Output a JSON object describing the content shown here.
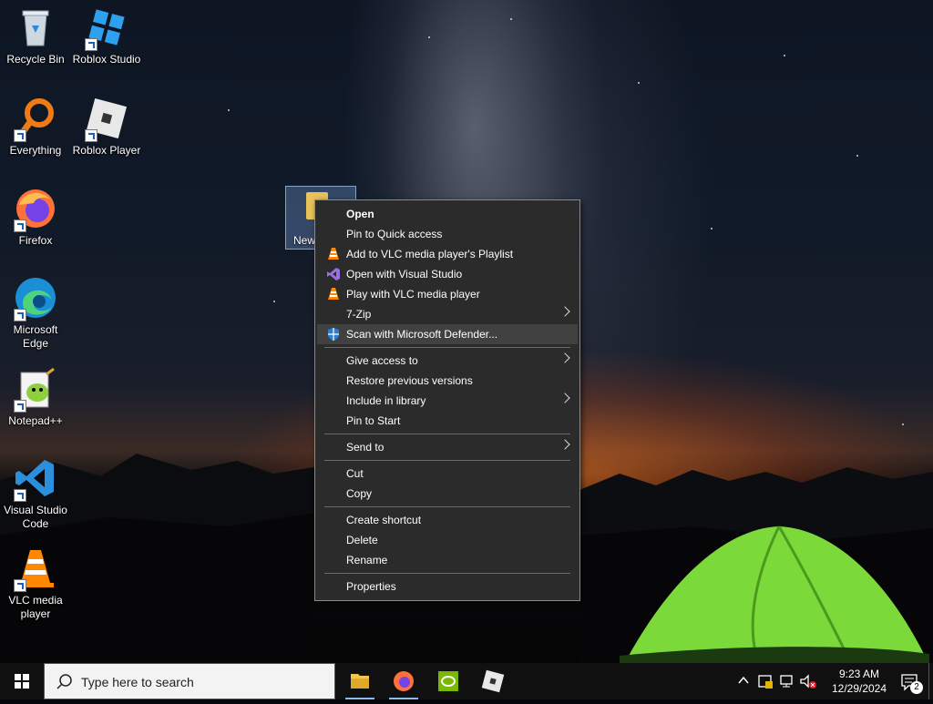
{
  "desktop_icons": [
    {
      "label": "Recycle Bin",
      "icon": "recycle-bin-icon"
    },
    {
      "label": "Roblox Studio",
      "icon": "roblox-studio-icon"
    },
    {
      "label": "Everything",
      "icon": "everything-icon"
    },
    {
      "label": "Roblox Player",
      "icon": "roblox-player-icon"
    },
    {
      "label": "Firefox",
      "icon": "firefox-icon"
    },
    {
      "label": "Microsoft Edge",
      "icon": "edge-icon"
    },
    {
      "label": "Notepad++",
      "icon": "notepad-plus-plus-icon"
    },
    {
      "label": "Visual Studio Code",
      "icon": "vscode-icon"
    },
    {
      "label": "VLC media player",
      "icon": "vlc-icon"
    }
  ],
  "selected_item": {
    "label": "New"
  },
  "context_menu": {
    "items": [
      {
        "label": "Open",
        "bold": true
      },
      {
        "label": "Pin to Quick access"
      },
      {
        "label": "Add to VLC media player's Playlist",
        "icon": "vlc-icon"
      },
      {
        "label": "Open with Visual Studio",
        "icon": "visual-studio-icon"
      },
      {
        "label": "Play with VLC media player",
        "icon": "vlc-icon"
      },
      {
        "label": "7-Zip",
        "submenu": true
      },
      {
        "label": "Scan with Microsoft Defender...",
        "icon": "defender-shield-icon",
        "highlighted": true
      },
      {
        "label": "Give access to",
        "submenu": true
      },
      {
        "label": "Restore previous versions"
      },
      {
        "label": "Include in library",
        "submenu": true
      },
      {
        "label": "Pin to Start"
      },
      {
        "label": "Send to",
        "submenu": true
      },
      {
        "label": "Cut"
      },
      {
        "label": "Copy"
      },
      {
        "label": "Create shortcut"
      },
      {
        "label": "Delete"
      },
      {
        "label": "Rename"
      },
      {
        "label": "Properties"
      }
    ]
  },
  "taskbar": {
    "search_placeholder": "Type here to search",
    "pinned": [
      "file-explorer-icon",
      "firefox-icon",
      "nvidia-icon",
      "roblox-icon"
    ],
    "tray": {
      "time": "9:23 AM",
      "date": "12/29/2024",
      "notification_count": "2"
    }
  },
  "colors": {
    "menu_bg": "#2b2b2b",
    "menu_highlight": "#414141",
    "taskbar_bg": "#101010",
    "tent_green": "#7cd93a"
  }
}
